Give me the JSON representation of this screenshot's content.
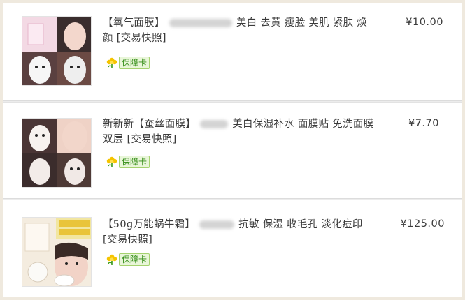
{
  "items": [
    {
      "title_prefix": "【氧气面膜】",
      "title_suffix": "美白 去黄 瘦脸 美肌 紧肤 焕颜 [交易快照]",
      "price": "¥10.00",
      "badge": "保障卡",
      "badge_icon": "flower-icon"
    },
    {
      "title_prefix": "新新新【蚕丝面膜】",
      "title_suffix": "美白保湿补水 面膜贴 免洗面膜 双层 [交易快照]",
      "price": "¥7.70",
      "badge": "保障卡",
      "badge_icon": "flower-icon"
    },
    {
      "title_prefix": "【50g万能蜗牛霜】",
      "title_suffix": "抗敏 保湿 收毛孔 淡化痘印 [交易快照]",
      "price": "¥125.00",
      "badge": "保障卡",
      "badge_icon": "flower-icon"
    }
  ],
  "colors": {
    "badge_green": "#2e8a12",
    "badge_bg": "#e9f6d9",
    "page_bg": "#efe9de"
  }
}
